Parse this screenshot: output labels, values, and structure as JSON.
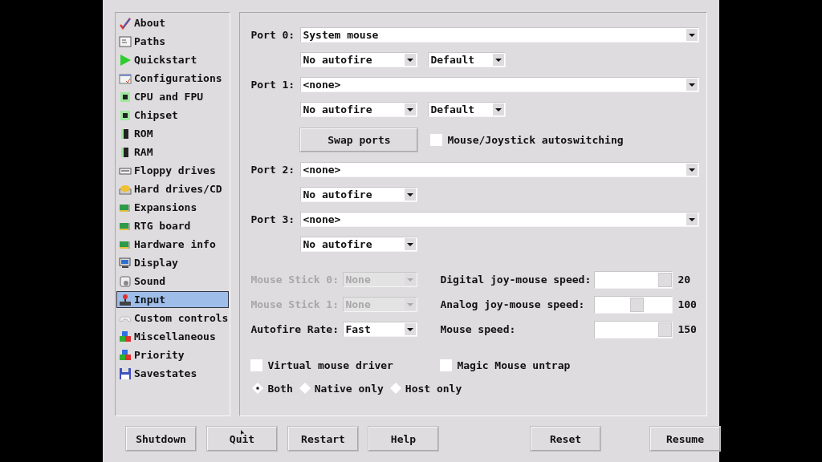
{
  "sidebar": {
    "items": [
      {
        "label": "About",
        "selected": false
      },
      {
        "label": "Paths",
        "selected": false
      },
      {
        "label": "Quickstart",
        "selected": false
      },
      {
        "label": "Configurations",
        "selected": false
      },
      {
        "label": "CPU and FPU",
        "selected": false
      },
      {
        "label": "Chipset",
        "selected": false
      },
      {
        "label": "ROM",
        "selected": false
      },
      {
        "label": "RAM",
        "selected": false
      },
      {
        "label": "Floppy drives",
        "selected": false
      },
      {
        "label": "Hard drives/CD",
        "selected": false
      },
      {
        "label": "Expansions",
        "selected": false
      },
      {
        "label": "RTG board",
        "selected": false
      },
      {
        "label": "Hardware info",
        "selected": false
      },
      {
        "label": "Display",
        "selected": false
      },
      {
        "label": "Sound",
        "selected": false
      },
      {
        "label": "Input",
        "selected": true
      },
      {
        "label": "Custom controls",
        "selected": false
      },
      {
        "label": "Miscellaneous",
        "selected": false
      },
      {
        "label": "Priority",
        "selected": false
      },
      {
        "label": "Savestates",
        "selected": false
      }
    ]
  },
  "ports": [
    {
      "label": "Port 0:",
      "device": "System mouse",
      "autofire": "No autofire",
      "mode": "Default"
    },
    {
      "label": "Port 1:",
      "device": "<none>",
      "autofire": "No autofire",
      "mode": "Default"
    },
    {
      "label": "Port 2:",
      "device": "<none>",
      "autofire": "No autofire"
    },
    {
      "label": "Port 3:",
      "device": "<none>",
      "autofire": "No autofire"
    }
  ],
  "swap_button": "Swap ports",
  "autoswitch": {
    "label": "Mouse/Joystick autoswitching",
    "checked": false
  },
  "left_settings": [
    {
      "label": "Mouse Stick 0:",
      "value": "None",
      "disabled": true
    },
    {
      "label": "Mouse Stick 1:",
      "value": "None",
      "disabled": true
    },
    {
      "label": "Autofire Rate:",
      "value": "Fast",
      "disabled": false
    }
  ],
  "sliders": [
    {
      "label": "Digital joy-mouse speed:",
      "level": 1.0,
      "reading": "20"
    },
    {
      "label": "Analog joy-mouse speed:",
      "level": 0.55,
      "reading": "100"
    },
    {
      "label": "Mouse speed:",
      "level": 1.0,
      "reading": "150"
    }
  ],
  "checkboxes": [
    {
      "label": "Virtual mouse driver",
      "checked": false
    },
    {
      "label": "Magic Mouse untrap",
      "checked": false
    }
  ],
  "mouse_modes": [
    {
      "label": "Both",
      "selected": true
    },
    {
      "label": "Native only",
      "selected": false
    },
    {
      "label": "Host only",
      "selected": false
    }
  ],
  "buttons": [
    {
      "label": "Shutdown"
    },
    {
      "label": "Quit"
    },
    {
      "label": "Restart"
    },
    {
      "label": "Help"
    },
    {
      "label": "Reset"
    },
    {
      "label": "Resume"
    }
  ]
}
